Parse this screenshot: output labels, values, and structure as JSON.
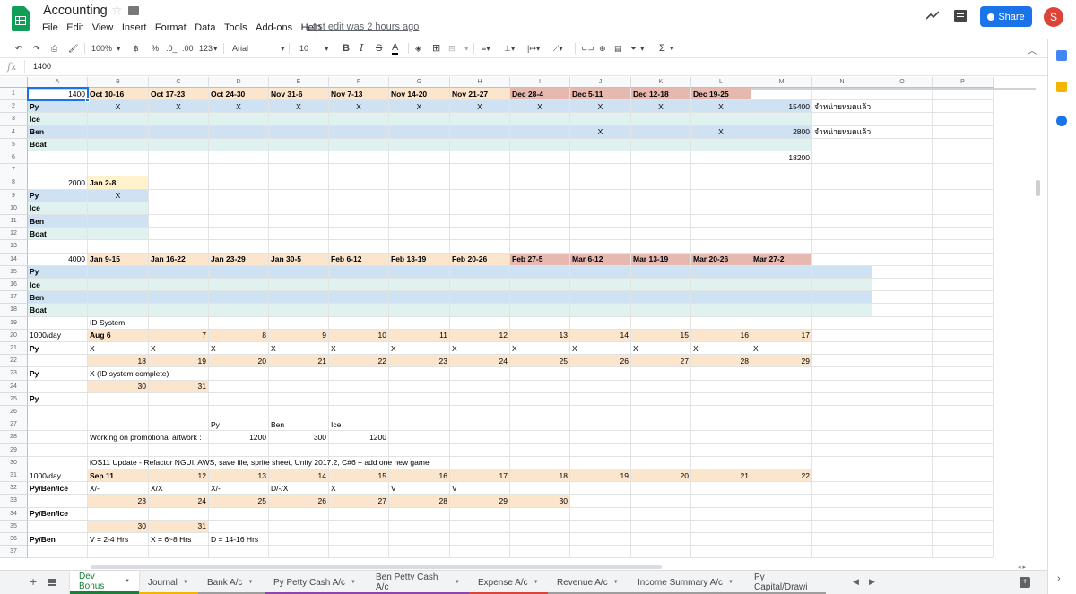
{
  "doc": {
    "title": "Accounting",
    "last_edit": "Last edit was 2 hours ago"
  },
  "menu": [
    "File",
    "Edit",
    "View",
    "Insert",
    "Format",
    "Data",
    "Tools",
    "Add-ons",
    "Help"
  ],
  "header": {
    "share_label": "Share",
    "avatar_letter": "S"
  },
  "toolbar": {
    "zoom": "100%",
    "currency": "฿",
    "percent": "%",
    "decimal_less": ".0_",
    "decimal_more": ".00",
    "number_format": "123",
    "font": "Arial",
    "font_size": "10",
    "bold": "B",
    "italic": "I",
    "strike": "S",
    "text_color": "A",
    "functions": "Σ"
  },
  "formula_bar": {
    "fx": "fx",
    "value": "1400"
  },
  "columns": [
    "A",
    "B",
    "C",
    "D",
    "E",
    "F",
    "G",
    "H",
    "I",
    "J",
    "K",
    "L",
    "M",
    "N",
    "O",
    "P"
  ],
  "rows": [
    "1",
    "2",
    "3",
    "4",
    "5",
    "6",
    "7",
    "8",
    "9",
    "10",
    "11",
    "12",
    "13",
    "14",
    "15",
    "16",
    "17",
    "18",
    "19",
    "20",
    "21",
    "22",
    "23",
    "24",
    "25",
    "26",
    "27",
    "28",
    "29",
    "30",
    "31",
    "32",
    "33",
    "34",
    "35",
    "36",
    "37"
  ],
  "cells": [
    {
      "r": 1,
      "c": 0,
      "t": "1400",
      "a": "r"
    },
    {
      "r": 1,
      "c": 1,
      "t": "Oct 10-16",
      "b": 1
    },
    {
      "r": 1,
      "c": 2,
      "t": "Oct 17-23",
      "b": 1
    },
    {
      "r": 1,
      "c": 3,
      "t": "Oct 24-30",
      "b": 1
    },
    {
      "r": 1,
      "c": 4,
      "t": "Nov 31-6",
      "b": 1
    },
    {
      "r": 1,
      "c": 5,
      "t": "Nov 7-13",
      "b": 1
    },
    {
      "r": 1,
      "c": 6,
      "t": "Nov 14-20",
      "b": 1
    },
    {
      "r": 1,
      "c": 7,
      "t": "Nov 21-27",
      "b": 1
    },
    {
      "r": 1,
      "c": 8,
      "t": "Dec 28-4",
      "b": 1
    },
    {
      "r": 1,
      "c": 9,
      "t": "Dec 5-11",
      "b": 1
    },
    {
      "r": 1,
      "c": 10,
      "t": "Dec 12-18",
      "b": 1
    },
    {
      "r": 1,
      "c": 11,
      "t": "Dec 19-25",
      "b": 1
    },
    {
      "r": 2,
      "c": 0,
      "t": "Py",
      "b": 1
    },
    {
      "r": 2,
      "c": 1,
      "t": "X",
      "a": "c"
    },
    {
      "r": 2,
      "c": 2,
      "t": "X",
      "a": "c"
    },
    {
      "r": 2,
      "c": 3,
      "t": "X",
      "a": "c"
    },
    {
      "r": 2,
      "c": 4,
      "t": "X",
      "a": "c"
    },
    {
      "r": 2,
      "c": 5,
      "t": "X",
      "a": "c"
    },
    {
      "r": 2,
      "c": 6,
      "t": "X",
      "a": "c"
    },
    {
      "r": 2,
      "c": 7,
      "t": "X",
      "a": "c"
    },
    {
      "r": 2,
      "c": 8,
      "t": "X",
      "a": "c"
    },
    {
      "r": 2,
      "c": 9,
      "t": "X",
      "a": "c"
    },
    {
      "r": 2,
      "c": 10,
      "t": "X",
      "a": "c"
    },
    {
      "r": 2,
      "c": 11,
      "t": "X",
      "a": "c"
    },
    {
      "r": 2,
      "c": 12,
      "t": "15400",
      "a": "r"
    },
    {
      "r": 2,
      "c": 13,
      "t": "จำหน่ายหมดแล้ว"
    },
    {
      "r": 3,
      "c": 0,
      "t": "Ice",
      "b": 1
    },
    {
      "r": 4,
      "c": 0,
      "t": "Ben",
      "b": 1
    },
    {
      "r": 4,
      "c": 9,
      "t": "X",
      "a": "c"
    },
    {
      "r": 4,
      "c": 11,
      "t": "X",
      "a": "c"
    },
    {
      "r": 4,
      "c": 12,
      "t": "2800",
      "a": "r"
    },
    {
      "r": 4,
      "c": 13,
      "t": "จำหน่ายหมดแล้ว"
    },
    {
      "r": 5,
      "c": 0,
      "t": "Boat",
      "b": 1
    },
    {
      "r": 6,
      "c": 12,
      "t": "18200",
      "a": "r"
    },
    {
      "r": 8,
      "c": 0,
      "t": "2000",
      "a": "r"
    },
    {
      "r": 8,
      "c": 1,
      "t": "Jan 2-8",
      "b": 1
    },
    {
      "r": 9,
      "c": 0,
      "t": "Py",
      "b": 1
    },
    {
      "r": 9,
      "c": 1,
      "t": "X",
      "a": "c"
    },
    {
      "r": 10,
      "c": 0,
      "t": "Ice",
      "b": 1
    },
    {
      "r": 11,
      "c": 0,
      "t": "Ben",
      "b": 1
    },
    {
      "r": 12,
      "c": 0,
      "t": "Boat",
      "b": 1
    },
    {
      "r": 14,
      "c": 0,
      "t": "4000",
      "a": "r"
    },
    {
      "r": 14,
      "c": 1,
      "t": "Jan 9-15",
      "b": 1
    },
    {
      "r": 14,
      "c": 2,
      "t": "Jan 16-22",
      "b": 1
    },
    {
      "r": 14,
      "c": 3,
      "t": "Jan 23-29",
      "b": 1
    },
    {
      "r": 14,
      "c": 4,
      "t": "Jan 30-5",
      "b": 1
    },
    {
      "r": 14,
      "c": 5,
      "t": "Feb 6-12",
      "b": 1
    },
    {
      "r": 14,
      "c": 6,
      "t": "Feb 13-19",
      "b": 1
    },
    {
      "r": 14,
      "c": 7,
      "t": "Feb 20-26",
      "b": 1
    },
    {
      "r": 14,
      "c": 8,
      "t": "Feb 27-5",
      "b": 1
    },
    {
      "r": 14,
      "c": 9,
      "t": "Mar 6-12",
      "b": 1
    },
    {
      "r": 14,
      "c": 10,
      "t": "Mar 13-19",
      "b": 1
    },
    {
      "r": 14,
      "c": 11,
      "t": "Mar 20-26",
      "b": 1
    },
    {
      "r": 14,
      "c": 12,
      "t": "Mar 27-2",
      "b": 1
    },
    {
      "r": 15,
      "c": 0,
      "t": "Py",
      "b": 1
    },
    {
      "r": 16,
      "c": 0,
      "t": "Ice",
      "b": 1
    },
    {
      "r": 17,
      "c": 0,
      "t": "Ben",
      "b": 1
    },
    {
      "r": 18,
      "c": 0,
      "t": "Boat",
      "b": 1
    },
    {
      "r": 19,
      "c": 1,
      "t": "ID System"
    },
    {
      "r": 20,
      "c": 0,
      "t": "1000/day"
    },
    {
      "r": 20,
      "c": 1,
      "t": "Aug 6",
      "b": 1
    },
    {
      "r": 20,
      "c": 2,
      "t": "7",
      "a": "r"
    },
    {
      "r": 20,
      "c": 3,
      "t": "8",
      "a": "r"
    },
    {
      "r": 20,
      "c": 4,
      "t": "9",
      "a": "r"
    },
    {
      "r": 20,
      "c": 5,
      "t": "10",
      "a": "r"
    },
    {
      "r": 20,
      "c": 6,
      "t": "11",
      "a": "r"
    },
    {
      "r": 20,
      "c": 7,
      "t": "12",
      "a": "r"
    },
    {
      "r": 20,
      "c": 8,
      "t": "13",
      "a": "r"
    },
    {
      "r": 20,
      "c": 9,
      "t": "14",
      "a": "r"
    },
    {
      "r": 20,
      "c": 10,
      "t": "15",
      "a": "r"
    },
    {
      "r": 20,
      "c": 11,
      "t": "16",
      "a": "r"
    },
    {
      "r": 20,
      "c": 12,
      "t": "17",
      "a": "r"
    },
    {
      "r": 21,
      "c": 0,
      "t": "Py",
      "b": 1
    },
    {
      "r": 21,
      "c": 1,
      "t": "X"
    },
    {
      "r": 21,
      "c": 2,
      "t": "X"
    },
    {
      "r": 21,
      "c": 3,
      "t": "X"
    },
    {
      "r": 21,
      "c": 4,
      "t": "X"
    },
    {
      "r": 21,
      "c": 5,
      "t": "X"
    },
    {
      "r": 21,
      "c": 6,
      "t": "X"
    },
    {
      "r": 21,
      "c": 7,
      "t": "X"
    },
    {
      "r": 21,
      "c": 8,
      "t": "X"
    },
    {
      "r": 21,
      "c": 9,
      "t": "X"
    },
    {
      "r": 21,
      "c": 10,
      "t": "X"
    },
    {
      "r": 21,
      "c": 11,
      "t": "X"
    },
    {
      "r": 21,
      "c": 12,
      "t": "X"
    },
    {
      "r": 22,
      "c": 1,
      "t": "18",
      "a": "r"
    },
    {
      "r": 22,
      "c": 2,
      "t": "19",
      "a": "r"
    },
    {
      "r": 22,
      "c": 3,
      "t": "20",
      "a": "r"
    },
    {
      "r": 22,
      "c": 4,
      "t": "21",
      "a": "r"
    },
    {
      "r": 22,
      "c": 5,
      "t": "22",
      "a": "r"
    },
    {
      "r": 22,
      "c": 6,
      "t": "23",
      "a": "r"
    },
    {
      "r": 22,
      "c": 7,
      "t": "24",
      "a": "r"
    },
    {
      "r": 22,
      "c": 8,
      "t": "25",
      "a": "r"
    },
    {
      "r": 22,
      "c": 9,
      "t": "26",
      "a": "r"
    },
    {
      "r": 22,
      "c": 10,
      "t": "27",
      "a": "r"
    },
    {
      "r": 22,
      "c": 11,
      "t": "28",
      "a": "r"
    },
    {
      "r": 22,
      "c": 12,
      "t": "29",
      "a": "r"
    },
    {
      "r": 23,
      "c": 0,
      "t": "Py",
      "b": 1
    },
    {
      "r": 23,
      "c": 1,
      "t": "X (ID system complete)"
    },
    {
      "r": 24,
      "c": 1,
      "t": "30",
      "a": "r"
    },
    {
      "r": 24,
      "c": 2,
      "t": "31",
      "a": "r"
    },
    {
      "r": 25,
      "c": 0,
      "t": "Py",
      "b": 1
    },
    {
      "r": 27,
      "c": 3,
      "t": "Py"
    },
    {
      "r": 27,
      "c": 4,
      "t": "Ben"
    },
    {
      "r": 27,
      "c": 5,
      "t": "Ice"
    },
    {
      "r": 28,
      "c": 1,
      "t": "Working on promotional artwork :"
    },
    {
      "r": 28,
      "c": 3,
      "t": "1200",
      "a": "r"
    },
    {
      "r": 28,
      "c": 4,
      "t": "300",
      "a": "r"
    },
    {
      "r": 28,
      "c": 5,
      "t": "1200",
      "a": "r"
    },
    {
      "r": 30,
      "c": 1,
      "t": "iOS11 Update - Refactor NGUI, AWS, save file, sprite sheet, Unity 2017.2, C#6 + add one new game"
    },
    {
      "r": 31,
      "c": 0,
      "t": "1000/day"
    },
    {
      "r": 31,
      "c": 1,
      "t": "Sep 11",
      "b": 1
    },
    {
      "r": 31,
      "c": 2,
      "t": "12",
      "a": "r"
    },
    {
      "r": 31,
      "c": 3,
      "t": "13",
      "a": "r"
    },
    {
      "r": 31,
      "c": 4,
      "t": "14",
      "a": "r"
    },
    {
      "r": 31,
      "c": 5,
      "t": "15",
      "a": "r"
    },
    {
      "r": 31,
      "c": 6,
      "t": "16",
      "a": "r"
    },
    {
      "r": 31,
      "c": 7,
      "t": "17",
      "a": "r"
    },
    {
      "r": 31,
      "c": 8,
      "t": "18",
      "a": "r"
    },
    {
      "r": 31,
      "c": 9,
      "t": "19",
      "a": "r"
    },
    {
      "r": 31,
      "c": 10,
      "t": "20",
      "a": "r"
    },
    {
      "r": 31,
      "c": 11,
      "t": "21",
      "a": "r"
    },
    {
      "r": 31,
      "c": 12,
      "t": "22",
      "a": "r"
    },
    {
      "r": 32,
      "c": 0,
      "t": "Py/Ben/Ice",
      "b": 1
    },
    {
      "r": 32,
      "c": 1,
      "t": "X/-"
    },
    {
      "r": 32,
      "c": 2,
      "t": "X/X"
    },
    {
      "r": 32,
      "c": 3,
      "t": "X/-"
    },
    {
      "r": 32,
      "c": 4,
      "t": "D/-/X"
    },
    {
      "r": 32,
      "c": 5,
      "t": "X"
    },
    {
      "r": 32,
      "c": 6,
      "t": "V"
    },
    {
      "r": 32,
      "c": 7,
      "t": "V"
    },
    {
      "r": 33,
      "c": 1,
      "t": "23",
      "a": "r"
    },
    {
      "r": 33,
      "c": 2,
      "t": "24",
      "a": "r"
    },
    {
      "r": 33,
      "c": 3,
      "t": "25",
      "a": "r"
    },
    {
      "r": 33,
      "c": 4,
      "t": "26",
      "a": "r"
    },
    {
      "r": 33,
      "c": 5,
      "t": "27",
      "a": "r"
    },
    {
      "r": 33,
      "c": 6,
      "t": "28",
      "a": "r"
    },
    {
      "r": 33,
      "c": 7,
      "t": "29",
      "a": "r"
    },
    {
      "r": 33,
      "c": 8,
      "t": "30",
      "a": "r"
    },
    {
      "r": 34,
      "c": 0,
      "t": "Py/Ben/Ice",
      "b": 1
    },
    {
      "r": 35,
      "c": 1,
      "t": "30",
      "a": "r"
    },
    {
      "r": 35,
      "c": 2,
      "t": "31",
      "a": "r"
    },
    {
      "r": 36,
      "c": 0,
      "t": "Py/Ben",
      "b": 1
    },
    {
      "r": 36,
      "c": 1,
      "t": "V = 2-4 Hrs"
    },
    {
      "r": 36,
      "c": 2,
      "t": "X = 6~8 Hrs"
    },
    {
      "r": 36,
      "c": 3,
      "t": "D = 14-16 Hrs"
    }
  ],
  "fills": [
    {
      "r": 1,
      "from": 1,
      "to": 7,
      "color": "#fce5cd"
    },
    {
      "r": 1,
      "from": 8,
      "to": 11,
      "color": "#e6b8af"
    },
    {
      "r": 2,
      "from": 0,
      "to": 12,
      "color": "#cfe2f3"
    },
    {
      "r": 3,
      "from": 0,
      "to": 12,
      "color": "#e0f2ef"
    },
    {
      "r": 4,
      "from": 0,
      "to": 12,
      "color": "#cfe2f3"
    },
    {
      "r": 5,
      "from": 0,
      "to": 12,
      "color": "#e0f2ef"
    },
    {
      "r": 8,
      "from": 1,
      "to": 1,
      "color": "#fff2cc"
    },
    {
      "r": 9,
      "from": 0,
      "to": 1,
      "color": "#cfe2f3"
    },
    {
      "r": 10,
      "from": 0,
      "to": 1,
      "color": "#e0f2ef"
    },
    {
      "r": 11,
      "from": 0,
      "to": 1,
      "color": "#cfe2f3"
    },
    {
      "r": 12,
      "from": 0,
      "to": 1,
      "color": "#e0f2ef"
    },
    {
      "r": 14,
      "from": 1,
      "to": 7,
      "color": "#fce5cd"
    },
    {
      "r": 14,
      "from": 8,
      "to": 12,
      "color": "#e6b8af"
    },
    {
      "r": 15,
      "from": 0,
      "to": 13,
      "color": "#cfe2f3"
    },
    {
      "r": 16,
      "from": 0,
      "to": 13,
      "color": "#e0f2ef"
    },
    {
      "r": 17,
      "from": 0,
      "to": 13,
      "color": "#cfe2f3"
    },
    {
      "r": 18,
      "from": 0,
      "to": 13,
      "color": "#e0f2ef"
    },
    {
      "r": 20,
      "from": 1,
      "to": 12,
      "color": "#fce5cd"
    },
    {
      "r": 22,
      "from": 1,
      "to": 12,
      "color": "#fce5cd"
    },
    {
      "r": 24,
      "from": 1,
      "to": 2,
      "color": "#fce5cd"
    },
    {
      "r": 31,
      "from": 1,
      "to": 12,
      "color": "#fce5cd"
    },
    {
      "r": 33,
      "from": 1,
      "to": 8,
      "color": "#fce5cd"
    },
    {
      "r": 35,
      "from": 1,
      "to": 2,
      "color": "#fce5cd"
    }
  ],
  "tabs": [
    {
      "label": "Dev Bonus",
      "active": true,
      "color": "#188038"
    },
    {
      "label": "Journal",
      "color": "#f4b400"
    },
    {
      "label": "Bank A/c",
      "color": "#9e9e9e"
    },
    {
      "label": "Py Petty Cash A/c",
      "color": "#8e44ad"
    },
    {
      "label": "Ben Petty Cash A/c",
      "color": "#8e44ad"
    },
    {
      "label": "Expense A/c",
      "color": "#db4437"
    },
    {
      "label": "Revenue A/c",
      "color": "#9e9e9e"
    },
    {
      "label": "Income Summary A/c",
      "color": "#9e9e9e"
    },
    {
      "label": "Py Capital/Drawi",
      "color": "#9e9e9e"
    }
  ]
}
